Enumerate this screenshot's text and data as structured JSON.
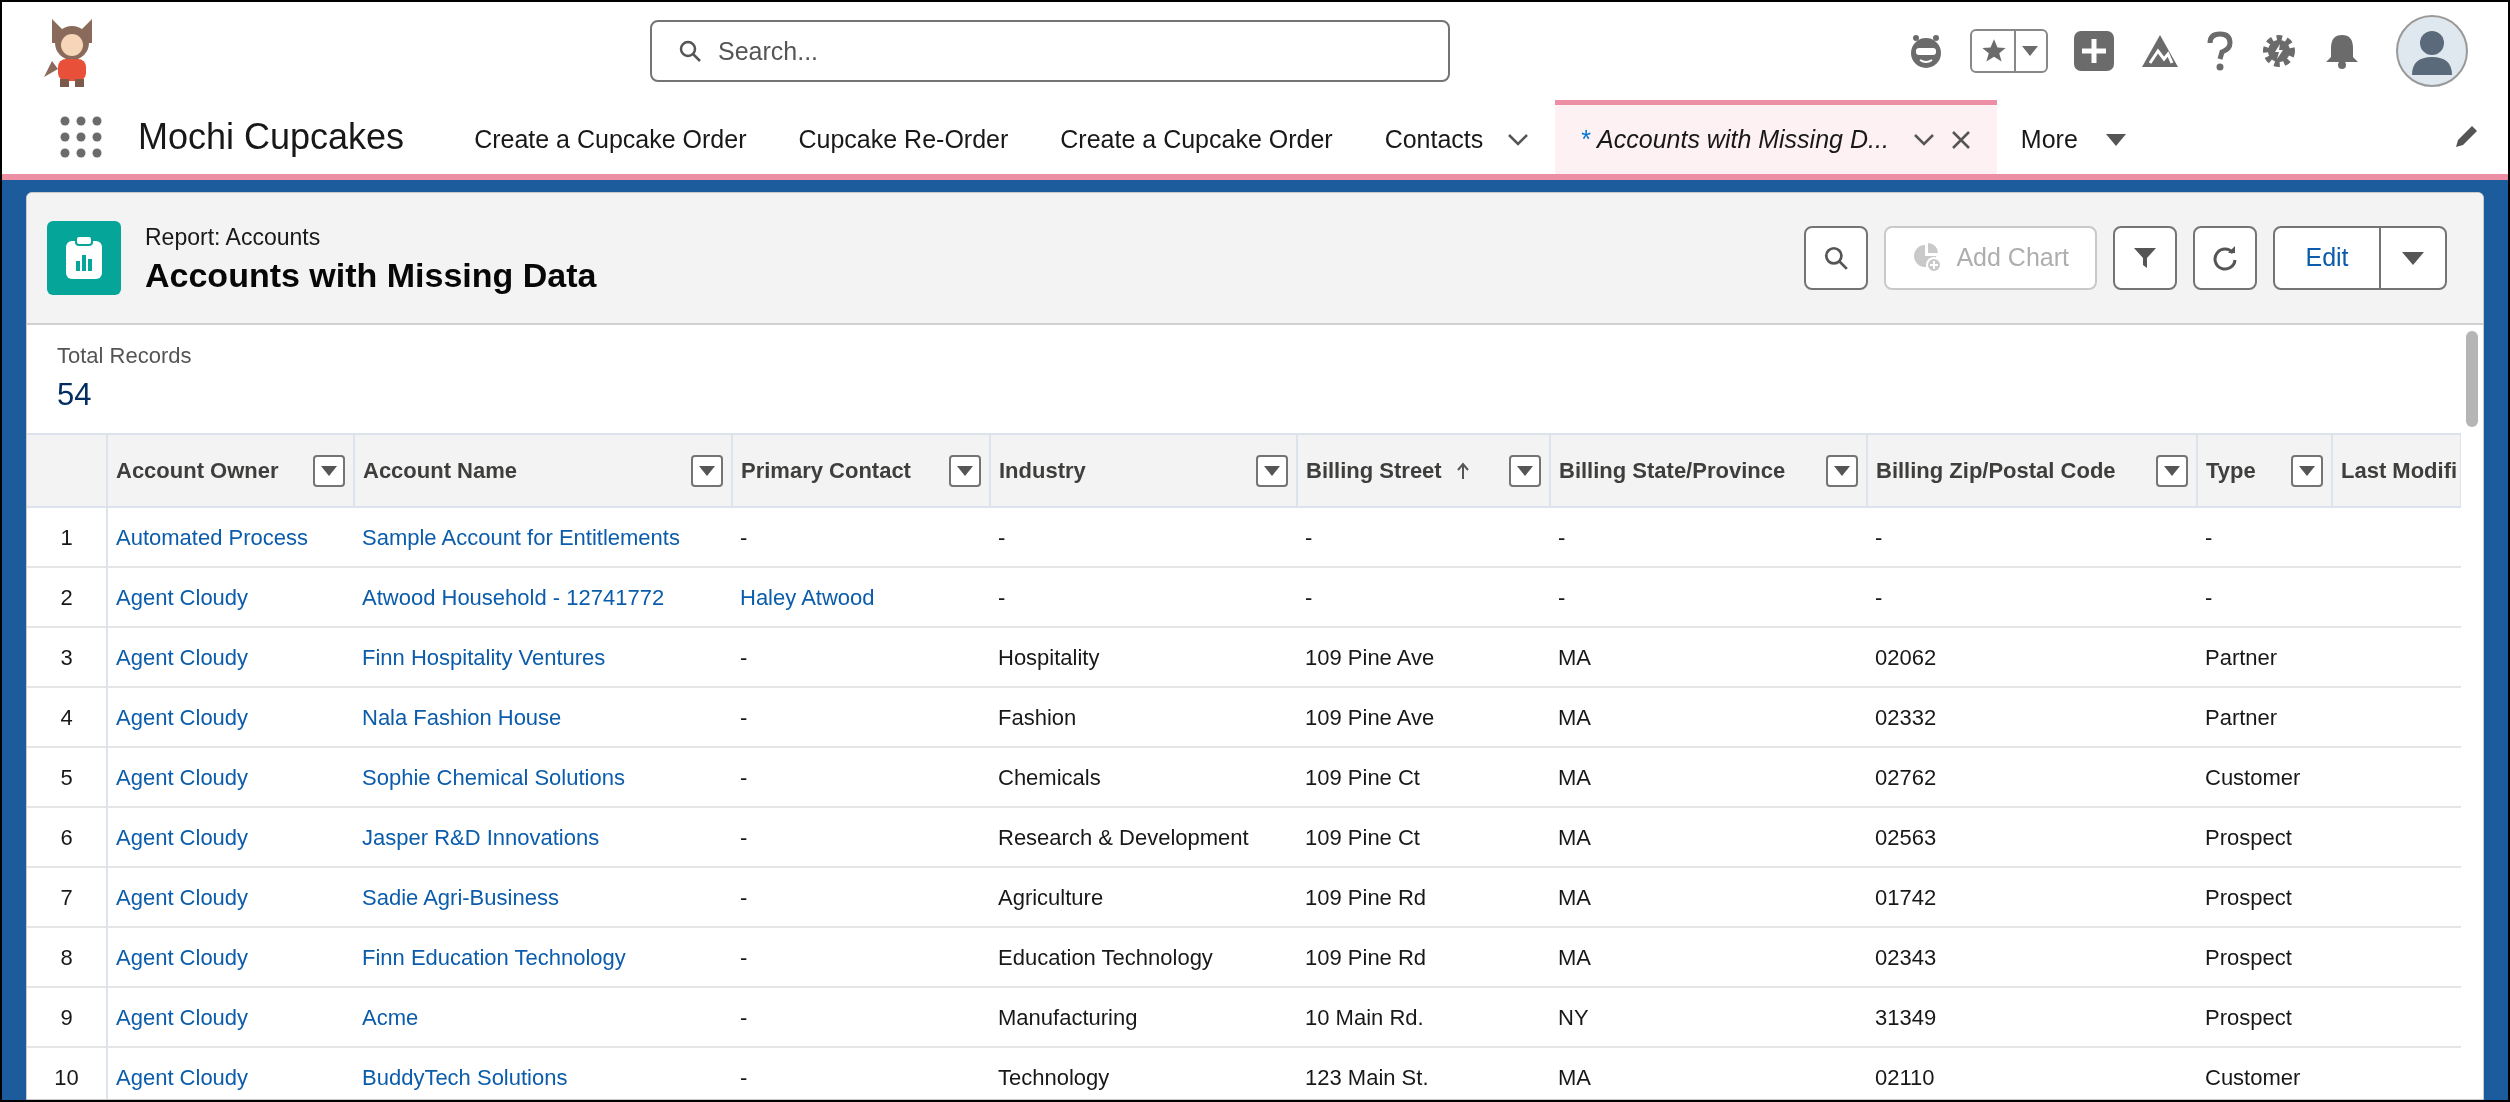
{
  "header": {
    "search": {
      "placeholder": "Search..."
    }
  },
  "nav": {
    "app_name": "Mochi Cupcakes",
    "tabs": [
      {
        "label": "Create a Cupcake Order",
        "selected": false,
        "menu": false,
        "closable": false
      },
      {
        "label": "Cupcake Re-Order",
        "selected": false,
        "menu": false,
        "closable": false
      },
      {
        "label": "Create a Cupcake Order",
        "selected": false,
        "menu": false,
        "closable": false
      },
      {
        "label": "Contacts",
        "selected": false,
        "menu": true,
        "closable": false
      },
      {
        "prefix": "*",
        "label": "Accounts with Missing D...",
        "selected": true,
        "menu": true,
        "closable": true
      }
    ],
    "more": "More"
  },
  "report": {
    "type_label": "Report: Accounts",
    "title": "Accounts with Missing Data",
    "add_chart": {
      "label": "Add Chart",
      "disabled": true
    },
    "edit": "Edit",
    "total_label": "Total Records",
    "total": "54"
  },
  "table": {
    "columns": [
      {
        "label": "Account Owner",
        "menu": true,
        "sorted": false
      },
      {
        "label": "Account Name",
        "menu": true,
        "sorted": false
      },
      {
        "label": "Primary Contact",
        "menu": true,
        "sorted": false
      },
      {
        "label": "Industry",
        "menu": true,
        "sorted": false
      },
      {
        "label": "Billing Street",
        "menu": true,
        "sorted": true
      },
      {
        "label": "Billing State/Province",
        "menu": true,
        "sorted": false
      },
      {
        "label": "Billing Zip/Postal Code",
        "menu": true,
        "sorted": false
      },
      {
        "label": "Type",
        "menu": true,
        "sorted": false
      },
      {
        "label": "Last Modifi",
        "menu": false,
        "sorted": false
      }
    ],
    "rows": [
      {
        "number": "1",
        "cells": [
          {
            "text": "Automated Process",
            "kind": "link"
          },
          {
            "text": "Sample Account for Entitlements",
            "kind": "link"
          },
          "-",
          "-",
          "-",
          "-",
          "-",
          "-"
        ]
      },
      {
        "number": "2",
        "cells": [
          {
            "text": "Agent Cloudy",
            "kind": "link"
          },
          {
            "text": "Atwood Household - 12741772",
            "kind": "link"
          },
          {
            "text": "Haley Atwood",
            "kind": "link"
          },
          "-",
          "-",
          "-",
          "-",
          "-"
        ]
      },
      {
        "number": "3",
        "cells": [
          {
            "text": "Agent Cloudy",
            "kind": "link"
          },
          {
            "text": "Finn Hospitality Ventures",
            "kind": "link"
          },
          "-",
          "Hospitality",
          "109 Pine Ave",
          "MA",
          "02062",
          "Partner"
        ]
      },
      {
        "number": "4",
        "cells": [
          {
            "text": "Agent Cloudy",
            "kind": "link"
          },
          {
            "text": "Nala Fashion House",
            "kind": "link"
          },
          "-",
          "Fashion",
          "109 Pine Ave",
          "MA",
          "02332",
          "Partner"
        ]
      },
      {
        "number": "5",
        "cells": [
          {
            "text": "Agent Cloudy",
            "kind": "link"
          },
          {
            "text": "Sophie Chemical Solutions",
            "kind": "link"
          },
          "-",
          "Chemicals",
          "109 Pine Ct",
          "MA",
          "02762",
          "Customer"
        ]
      },
      {
        "number": "6",
        "cells": [
          {
            "text": "Agent Cloudy",
            "kind": "link"
          },
          {
            "text": "Jasper R&D Innovations",
            "kind": "link"
          },
          "-",
          "Research & Development",
          "109 Pine Ct",
          "MA",
          "02563",
          "Prospect"
        ]
      },
      {
        "number": "7",
        "cells": [
          {
            "text": "Agent Cloudy",
            "kind": "link"
          },
          {
            "text": "Sadie Agri-Business",
            "kind": "link"
          },
          "-",
          "Agriculture",
          "109 Pine Rd",
          "MA",
          "01742",
          "Prospect"
        ]
      },
      {
        "number": "8",
        "cells": [
          {
            "text": "Agent Cloudy",
            "kind": "link"
          },
          {
            "text": "Finn Education Technology",
            "kind": "link"
          },
          "-",
          "Education Technology",
          "109 Pine Rd",
          "MA",
          "02343",
          "Prospect"
        ]
      },
      {
        "number": "9",
        "cells": [
          {
            "text": "Agent Cloudy",
            "kind": "link"
          },
          {
            "text": "Acme",
            "kind": "link"
          },
          "-",
          "Manufacturing",
          "10 Main Rd.",
          "NY",
          "31349",
          "Prospect"
        ]
      },
      {
        "number": "10",
        "cells": [
          {
            "text": "Agent Cloudy",
            "kind": "link"
          },
          {
            "text": "BuddyTech Solutions",
            "kind": "link"
          },
          "-",
          "Technology",
          "123 Main St.",
          "MA",
          "02110",
          "Customer"
        ]
      }
    ]
  }
}
